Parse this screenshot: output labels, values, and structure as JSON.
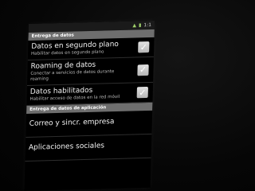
{
  "status_bar": {
    "time": "1:1"
  },
  "sections": {
    "data_delivery": "Entrega de datos",
    "app_data_delivery": "Entrega de datos de aplicación"
  },
  "settings": [
    {
      "title": "Datos en segundo plano",
      "summary": "Habilitar datos en segundo plano",
      "checked": true
    },
    {
      "title": "Roaming de datos",
      "summary": "Conectar a servicios de datos durante roaming",
      "checked": true
    },
    {
      "title": "Datos habilitados",
      "summary": "Habilitar acceso de datos en la red móvil",
      "checked": true
    }
  ],
  "app_items": [
    "Correo y sincr. empresa",
    "Aplicaciones sociales"
  ],
  "colors": {
    "section_bg": "#6e6e6e",
    "screen_bg": "#000000",
    "checkbox": "#c8c8c8"
  }
}
